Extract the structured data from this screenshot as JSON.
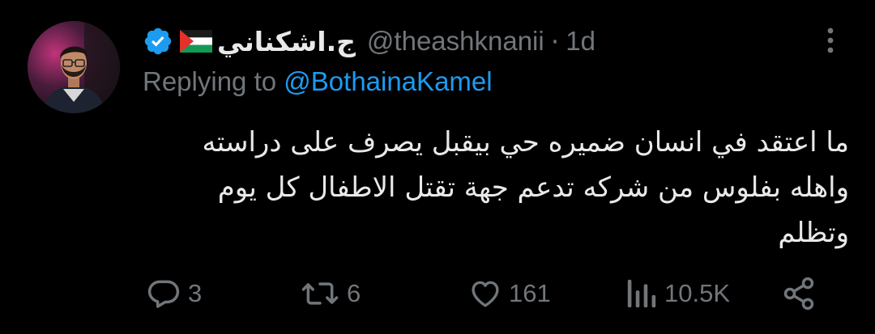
{
  "tweet": {
    "display_name": "ج.اشكناني",
    "handle": "@theashknanii",
    "separator": "·",
    "time": "1d",
    "reply_prefix": "Replying to",
    "reply_mention": "@BothainaKamel",
    "text_lines": [
      "ما اعتقد في انسان ضميره حي بيقبل يصرف على دراسته",
      "واهله بفلوس من شركه تدعم جهة تقتل الاطفال كل يوم",
      "وتظلم"
    ]
  },
  "actions": {
    "replies": "3",
    "reposts": "6",
    "likes": "161",
    "views": "10.5K"
  },
  "icons": {
    "verified": "verified-badge-icon",
    "flag": "palestine-flag-icon",
    "more": "more-vertical-icon",
    "reply": "reply-icon",
    "repost": "repost-icon",
    "like": "heart-icon",
    "views": "views-icon",
    "share": "share-icon"
  },
  "colors": {
    "background": "#000000",
    "text": "#e7e9ea",
    "muted": "#71767b",
    "accent": "#1d9bf0"
  }
}
